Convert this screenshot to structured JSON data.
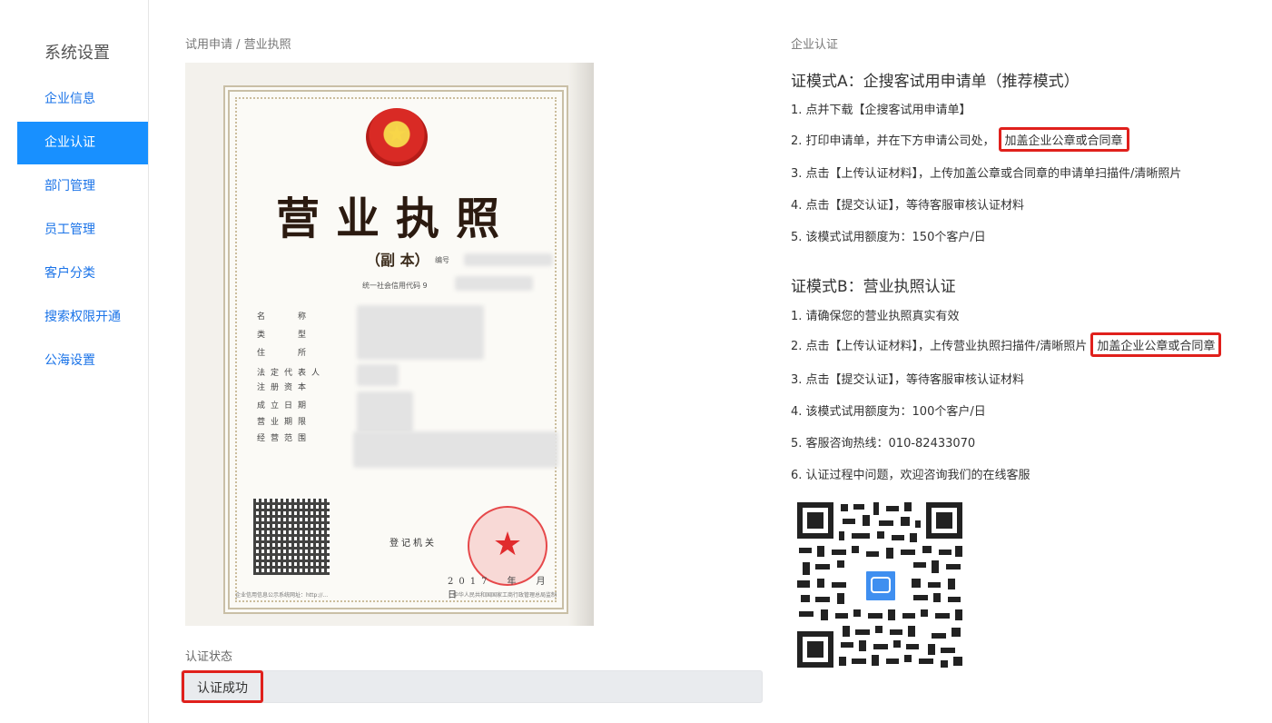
{
  "sidebar": {
    "title": "系统设置",
    "items": [
      {
        "label": "企业信息"
      },
      {
        "label": "企业认证"
      },
      {
        "label": "部门管理"
      },
      {
        "label": "员工管理"
      },
      {
        "label": "客户分类"
      },
      {
        "label": "搜索权限开通"
      },
      {
        "label": "公海设置"
      }
    ],
    "active_index": 1
  },
  "left": {
    "breadcrumb": "试用申请 / 营业执照",
    "license": {
      "title": "营业执照",
      "subtitle": "（副 本）",
      "number_label": "编号",
      "code_label": "统一社会信用代码 9",
      "fields": [
        "名　　称",
        "类　　型",
        "住　　所",
        "法定代表人",
        "注册资本",
        "成立日期",
        "营业期限",
        "经营范围"
      ],
      "reg_org": "登记机关",
      "date": "2017　年　月　日",
      "footer_left": "企业信用信息公示系统网址：http://...",
      "footer_right": "中华人民共和国国家工商行政管理总局监制"
    },
    "status_label": "认证状态",
    "status_value": "认证成功"
  },
  "right": {
    "header": "企业认证",
    "mode_a": {
      "title": "证模式A：企搜客试用申请单（推荐模式）",
      "steps": [
        "1. 点并下载【企搜客试用申请单】",
        "2. 打印申请单，并在下方申请公司处，",
        "3. 点击【上传认证材料】，上传加盖公章或合同章的申请单扫描件/清晰照片",
        "4. 点击【提交认证】，等待客服审核认证材料",
        "5. 该模式试用额度为：150个客户/日"
      ],
      "step2_highlight": "加盖企业公章或合同章"
    },
    "mode_b": {
      "title": "证模式B：营业执照认证",
      "steps": [
        "1. 请确保您的营业执照真实有效",
        "2. 点击【上传认证材料】，上传营业执照扫描件/清晰照片",
        "3. 点击【提交认证】，等待客服审核认证材料",
        "4. 该模式试用额度为：100个客户/日",
        "5. 客服咨询热线：010-82433070",
        "6. 认证过程中问题，欢迎咨询我们的在线客服"
      ],
      "step2_highlight": "加盖企业公章或合同章"
    }
  },
  "colors": {
    "accent": "#1890ff",
    "link": "#1a73e8",
    "highlight_border": "#e0201c"
  }
}
